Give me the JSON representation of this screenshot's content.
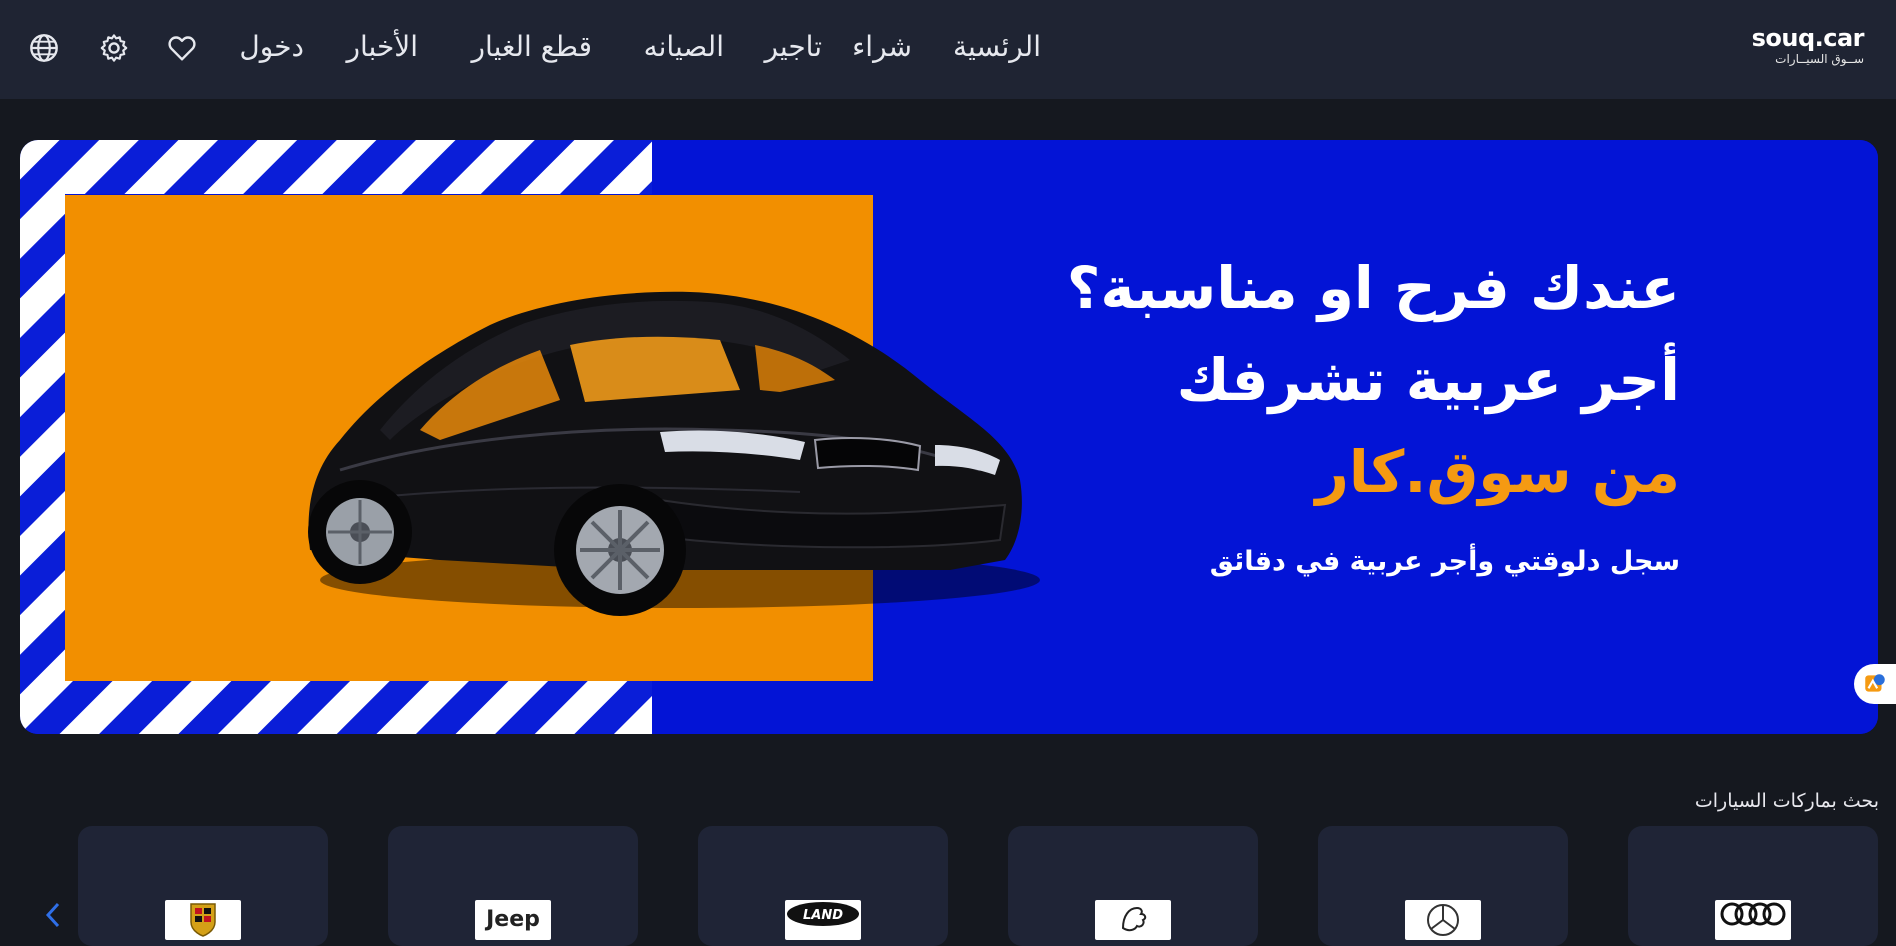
{
  "header": {
    "logo_main": "souq.car",
    "logo_sub": "ســوق السيــارات",
    "nav": [
      {
        "id": "home",
        "label": "الرئسية"
      },
      {
        "id": "buy",
        "label": "شراء"
      },
      {
        "id": "rent",
        "label": "تاجير"
      },
      {
        "id": "maintenance",
        "label": "الصيانه"
      },
      {
        "id": "parts",
        "label": "قطع الغيار"
      },
      {
        "id": "news",
        "label": "الأخبار"
      },
      {
        "id": "login",
        "label": "دخول"
      }
    ],
    "icons": [
      "heart-icon",
      "gear-icon",
      "globe-icon"
    ]
  },
  "hero": {
    "line1": "عندك فرح او مناسبة؟",
    "line2": "أجر عربية تشرفك",
    "line3": "من سوق.كار",
    "subline": "سجل دلوقتي وأجر عربية في دقائق",
    "colors": {
      "blue": "#0314d6",
      "orange": "#f28f00",
      "white": "#ffffff"
    }
  },
  "brands": {
    "title": "بحث بماركات السيارات",
    "items": [
      {
        "name": "Audi",
        "icon": "audi-logo"
      },
      {
        "name": "Mercedes-Benz",
        "icon": "mercedes-logo"
      },
      {
        "name": "Peugeot",
        "icon": "peugeot-logo"
      },
      {
        "name": "Land Rover",
        "icon": "land-rover-logo",
        "text": "LAND"
      },
      {
        "name": "Jeep",
        "icon": "jeep-logo",
        "text": "Jeep"
      },
      {
        "name": "Porsche",
        "icon": "porsche-logo"
      }
    ]
  }
}
